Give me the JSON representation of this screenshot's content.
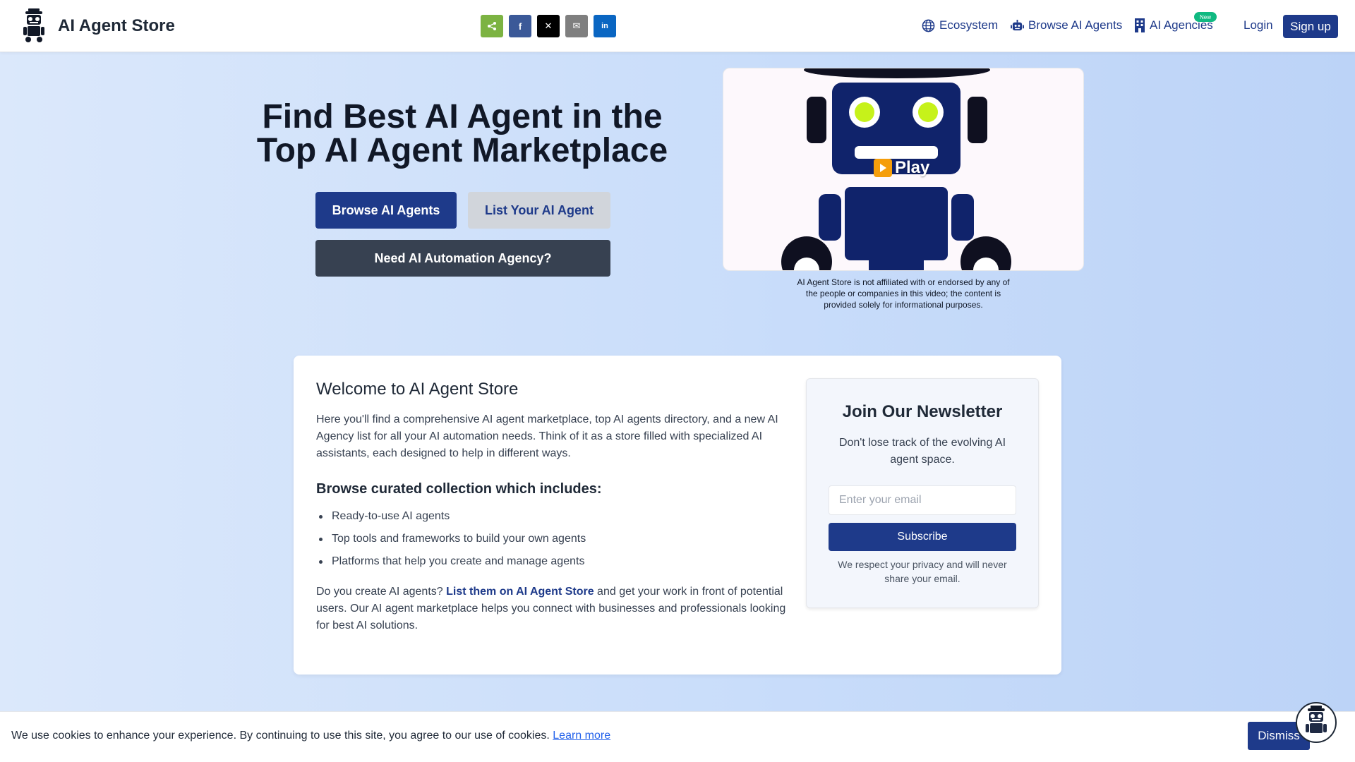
{
  "header": {
    "brand": "AI Agent Store",
    "share": [
      {
        "icon": "share-icon",
        "color": "#7cb342"
      },
      {
        "icon": "facebook-icon",
        "color": "#3b5998",
        "glyph": "f"
      },
      {
        "icon": "x-icon",
        "color": "#000000",
        "glyph": "𝕏"
      },
      {
        "icon": "email-icon",
        "color": "#7f7f7f",
        "glyph": "✉"
      },
      {
        "icon": "linkedin-icon",
        "color": "#0a66c2",
        "glyph": "in"
      }
    ],
    "nav": {
      "ecosystem": "Ecosystem",
      "browse": "Browse AI Agents",
      "agencies": "AI Agencies",
      "new_badge": "New",
      "login": "Login",
      "signup": "Sign up"
    }
  },
  "hero": {
    "title_line1": "Find Best AI Agent in the",
    "title_line2": "Top AI Agent Marketplace",
    "browse_button": "Browse AI Agents",
    "list_button": "List Your AI Agent",
    "agency_button": "Need AI Automation Agency?",
    "video": {
      "play_label": "Play",
      "disclaimer": "AI Agent Store is not affiliated with or endorsed by any of the people or companies in this video; the content is provided solely for informational purposes."
    }
  },
  "welcome": {
    "title": "Welcome to AI Agent Store",
    "intro": "Here you'll find a comprehensive AI agent marketplace, top AI agents directory, and a new AI Agency list for all your AI automation needs. Think of it as a store filled with specialized AI assistants, each designed to help in different ways.",
    "collection_title": "Browse curated collection which includes:",
    "items": [
      "Ready-to-use AI agents",
      "Top tools and frameworks to build your own agents",
      "Platforms that help you create and manage agents"
    ],
    "cta_prefix": "Do you create AI agents? ",
    "cta_link": "List them on AI Agent Store",
    "cta_suffix": " and get your work in front of potential users. Our AI agent marketplace helps you connect with businesses and professionals looking for best AI solutions."
  },
  "newsletter": {
    "title": "Join Our Newsletter",
    "text": "Don't lose track of the evolving AI agent space.",
    "placeholder": "Enter your email",
    "button": "Subscribe",
    "note": "We respect your privacy and will never share your email."
  },
  "cookie": {
    "text": "We use cookies to enhance your experience. By continuing to use this site, you agree to our use of cookies. ",
    "link": "Learn more",
    "dismiss": "Dismiss"
  },
  "colors": {
    "brand": "#1e3a8a",
    "new_badge": "#10b981",
    "robot_eye": "#c6f21a"
  }
}
